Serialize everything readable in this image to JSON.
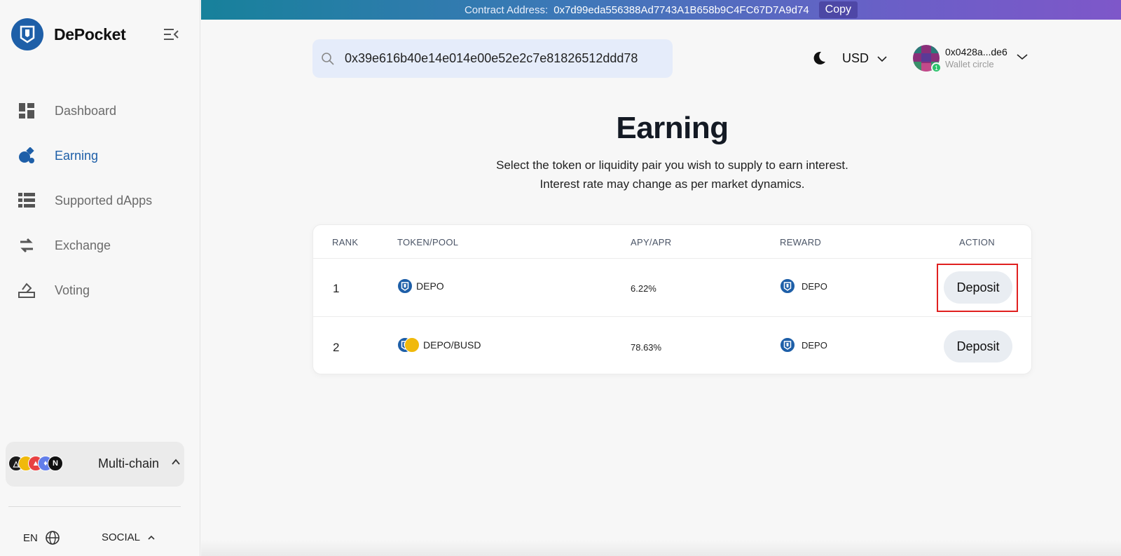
{
  "brand": {
    "name": "DePocket"
  },
  "sidebar": {
    "items": [
      {
        "label": "Dashboard",
        "icon": "dashboard-icon",
        "active": false
      },
      {
        "label": "Earning",
        "icon": "earning-icon",
        "active": true
      },
      {
        "label": "Supported dApps",
        "icon": "list-icon",
        "active": false
      },
      {
        "label": "Exchange",
        "icon": "exchange-icon",
        "active": false
      },
      {
        "label": "Voting",
        "icon": "voting-icon",
        "active": false
      }
    ],
    "chain_label": "Multi-chain",
    "language": "EN",
    "social_label": "SOCIAL"
  },
  "banner": {
    "label": "Contract Address:",
    "address": "0x7d99eda556388Ad7743A1B658b9C4FC67D7A9d74",
    "copy_label": "Copy"
  },
  "header": {
    "search_value": "0x39e616b40e14e014e00e52e2c7e81826512ddd78",
    "currency": "USD",
    "account_address": "0x0428a...de6",
    "account_sub": "Wallet circle",
    "account_badge": "1"
  },
  "main": {
    "title": "Earning",
    "subtitle_line1": "Select the token or liquidity pair you wish to supply to earn interest.",
    "subtitle_line2": "Interest rate may change as per market dynamics."
  },
  "table": {
    "headers": {
      "rank": "RANK",
      "token": "TOKEN/POOL",
      "apy": "APY/APR",
      "reward": "REWARD",
      "action": "ACTION"
    },
    "rows": [
      {
        "rank": "1",
        "token": "DEPO",
        "apy": "6.22%",
        "reward": "DEPO",
        "action": "Deposit"
      },
      {
        "rank": "2",
        "token": "DEPO/BUSD",
        "apy": "78.63%",
        "reward": "DEPO",
        "action": "Deposit"
      }
    ]
  },
  "colors": {
    "accent": "#1e5fa8",
    "highlight": "#e0201f",
    "busd": "#f0b90b"
  }
}
